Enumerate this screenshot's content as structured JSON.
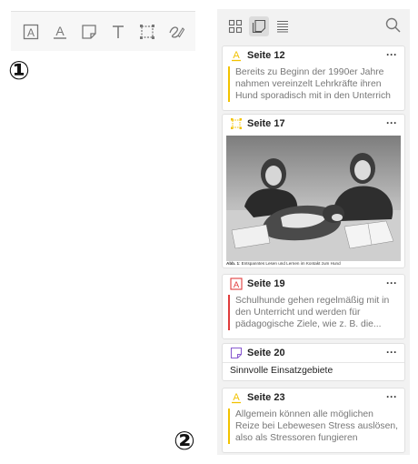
{
  "markers": {
    "one": "①",
    "two": "②"
  },
  "toolbar": {
    "tools": [
      {
        "name": "area-text-highlight-icon"
      },
      {
        "name": "text-underline-icon"
      },
      {
        "name": "note-icon"
      },
      {
        "name": "text-tool-icon"
      },
      {
        "name": "area-select-icon"
      },
      {
        "name": "ink-pen-icon"
      }
    ]
  },
  "panel": {
    "header": {
      "buttons": [
        "grid-view-icon",
        "annotations-view-icon",
        "list-view-icon"
      ],
      "search": "search-icon"
    },
    "cards": [
      {
        "title": "Seite 12",
        "icon": "text-underline-icon",
        "color": "#f2c200",
        "text": "Bereits zu Beginn der 1990er Jahre nahmen vereinzelt Lehrkräfte ihren Hund sporadisch mit in den Unterrich"
      },
      {
        "title": "Seite 17",
        "icon": "area-select-icon",
        "color": "#f2c200",
        "caption_bold": "Abb. 1",
        "caption": ": Entspanntes Lesen und Lernen im Kontakt zum Hund"
      },
      {
        "title": "Seite 19",
        "icon": "area-text-highlight-icon",
        "color": "#e03c3c",
        "text": "Schulhunde gehen regelmäßig mit in den Unterricht und werden für pädagogische Ziele, wie z. B. die..."
      },
      {
        "title": "Seite 20",
        "icon": "note-icon",
        "color": "#8a5cd0",
        "note": "Sinnvolle Einsatzgebiete"
      },
      {
        "title": "Seite 23",
        "icon": "text-underline-icon",
        "color": "#f2c200",
        "text": "Allgemein können alle möglichen Reize bei Lebewesen Stress auslösen, also als Stressoren fungieren"
      }
    ],
    "more_label": "···"
  }
}
